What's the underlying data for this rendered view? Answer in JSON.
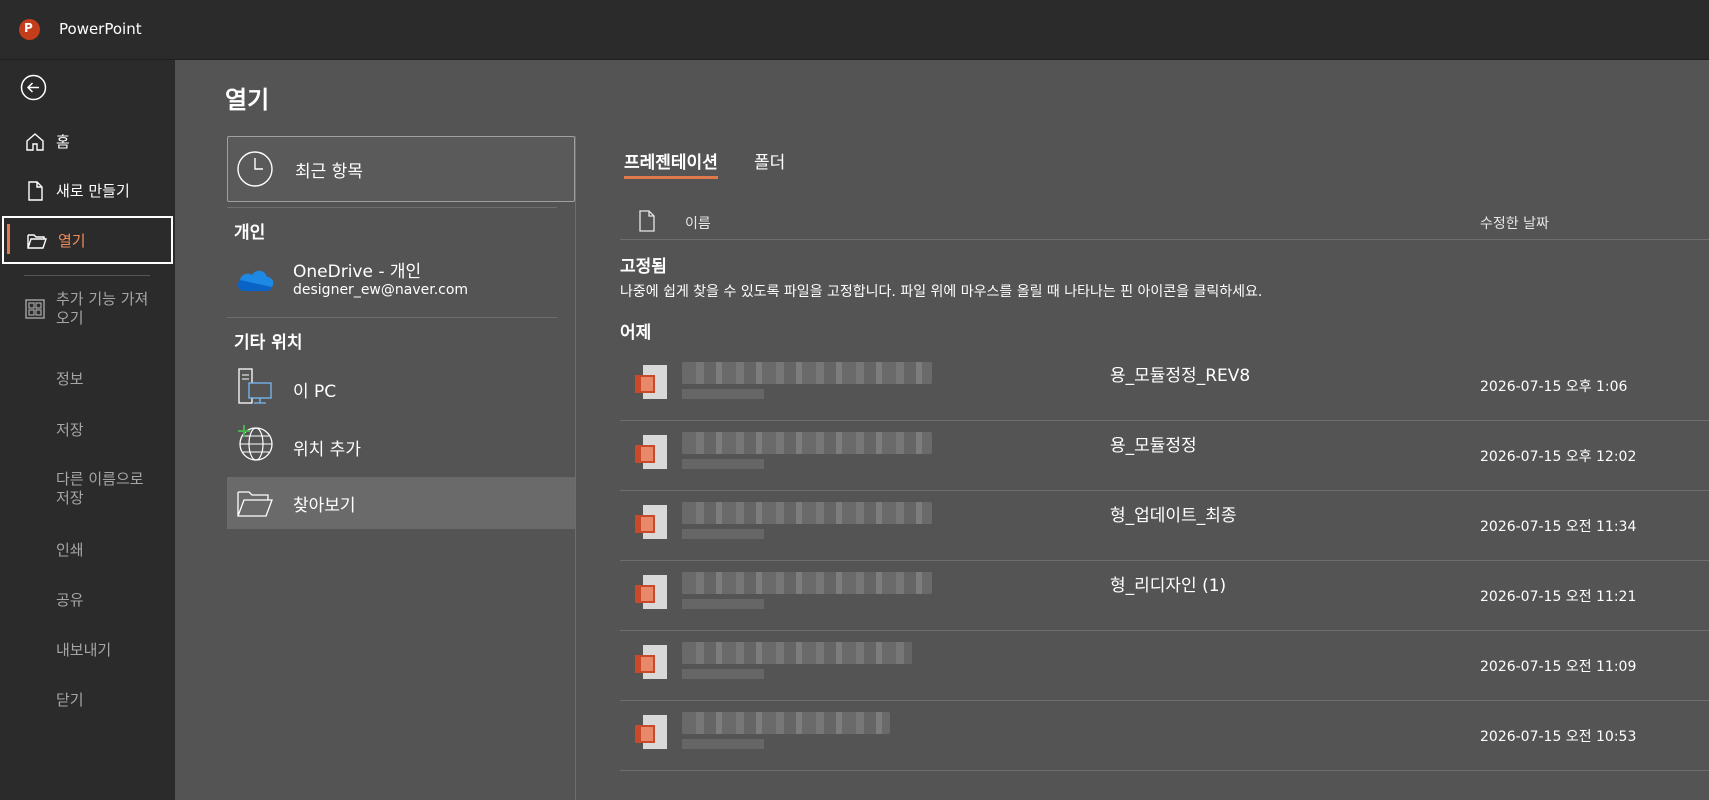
{
  "app": {
    "title": "PowerPoint",
    "logo_icon": "powerpoint-logo-icon"
  },
  "nav": {
    "back_icon": "back-arrow-icon",
    "items": [
      {
        "label": "홈",
        "icon": "home-icon"
      },
      {
        "label": "새로 만들기",
        "icon": "new-document-icon"
      },
      {
        "label": "열기",
        "icon": "folder-open-icon",
        "active": true
      },
      {
        "label": "추가 기능 가져\n오기",
        "icon": "add-ins-icon"
      }
    ],
    "sub_items": [
      "정보",
      "저장",
      "다른 이름으로\n저장",
      "인쇄",
      "공유",
      "내보내기",
      "닫기"
    ]
  },
  "page": {
    "title": "열기"
  },
  "locations": {
    "recent": {
      "label": "최근 항목",
      "icon": "clock-icon"
    },
    "personal_heading": "개인",
    "onedrive": {
      "name": "OneDrive - 개인",
      "email": "designer_ew@naver.com",
      "icon": "onedrive-cloud-icon"
    },
    "other_heading": "기타 위치",
    "this_pc": {
      "label": "이 PC",
      "icon": "computer-icon"
    },
    "add_place": {
      "label": "위치 추가",
      "icon": "globe-add-icon"
    },
    "browse": {
      "label": "찾아보기",
      "icon": "folder-browse-icon"
    }
  },
  "files": {
    "tabs": [
      {
        "label": "프레젠테이션",
        "active": true
      },
      {
        "label": "폴더",
        "active": false
      }
    ],
    "columns": {
      "name": "이름",
      "modified": "수정한 날짜"
    },
    "pinned": {
      "title": "고정됨",
      "description": "나중에 쉽게 찾을 수 있도록 파일을 고정합니다. 파일 위에 마우스를 올릴 때 나타나는 핀 아이콘을 클릭하세요."
    },
    "yesterday": {
      "title": "어제",
      "items": [
        {
          "name": "용_모듈정정_REV8",
          "date": "2026-07-15 오후 1:06"
        },
        {
          "name": "용_모듈정정",
          "date": "2026-07-15 오후 12:02"
        },
        {
          "name": "형_업데이트_최종",
          "date": "2026-07-15 오전 11:34"
        },
        {
          "name": "형_리디자인 (1)",
          "date": "2026-07-15 오전 11:21"
        },
        {
          "name": "",
          "date": "2026-07-15 오전 11:09"
        },
        {
          "name": "",
          "date": "2026-07-15 오전 10:53"
        }
      ]
    }
  },
  "colors": {
    "accent": "#e0784e",
    "titlebar": "#2b2b2b",
    "main_bg": "#545454",
    "ppt_red": "#c43e1c"
  }
}
